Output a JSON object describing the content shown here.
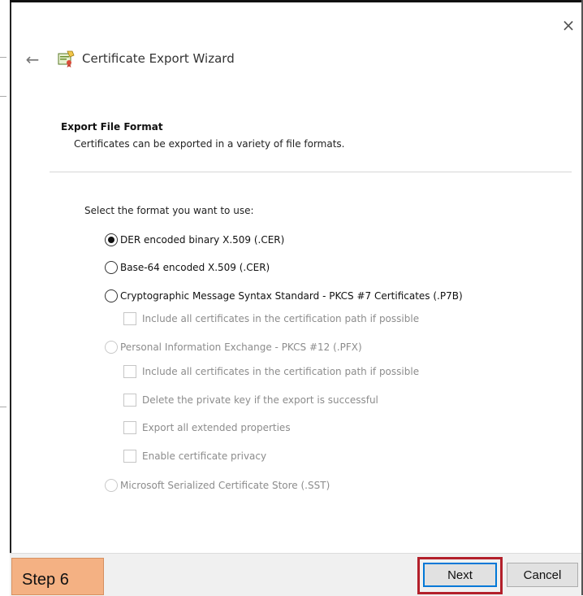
{
  "window": {
    "title": "Certificate Export Wizard",
    "close_label": "×",
    "back_label": "←"
  },
  "section": {
    "title": "Export File Format",
    "description": "Certificates can be exported in a variety of file formats."
  },
  "prompt": "Select the format you want to use:",
  "options": [
    {
      "label": "DER encoded binary X.509 (.CER)",
      "selected": true,
      "enabled": true
    },
    {
      "label": "Base-64 encoded X.509 (.CER)",
      "selected": false,
      "enabled": true
    },
    {
      "label": "Cryptographic Message Syntax Standard - PKCS #7 Certificates (.P7B)",
      "selected": false,
      "enabled": true
    },
    {
      "label": "Personal Information Exchange - PKCS #12 (.PFX)",
      "selected": false,
      "enabled": false
    },
    {
      "label": "Microsoft Serialized Certificate Store (.SST)",
      "selected": false,
      "enabled": false
    }
  ],
  "p7b_checkboxes": [
    {
      "label": "Include all certificates in the certification path if possible",
      "checked": false,
      "enabled": false
    }
  ],
  "pfx_checkboxes": [
    {
      "label": "Include all certificates in the certification path if possible",
      "checked": false,
      "enabled": false
    },
    {
      "label": "Delete the private key if the export is successful",
      "checked": false,
      "enabled": false
    },
    {
      "label": "Export all extended properties",
      "checked": false,
      "enabled": false
    },
    {
      "label": "Enable certificate privacy",
      "checked": false,
      "enabled": false
    }
  ],
  "footer": {
    "step_label": "Step 6",
    "next_label": "Next",
    "cancel_label": "Cancel"
  },
  "colors": {
    "step_badge": "#f4b183",
    "highlight_outline": "#b3202b",
    "focus_border": "#0078d7"
  },
  "icons": {
    "wizard": "certificate-wizard-icon",
    "back": "back-arrow-icon",
    "close": "close-icon"
  }
}
